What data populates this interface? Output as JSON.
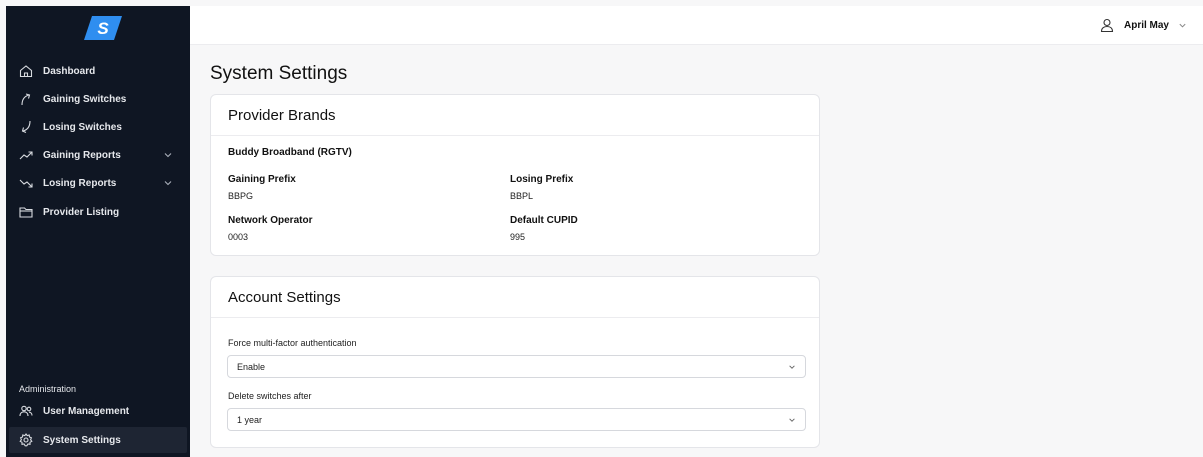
{
  "logo": {
    "letter": "S",
    "color": "#2f8ef0"
  },
  "sidebar": {
    "items": [
      {
        "label": "Dashboard",
        "icon": "home-icon"
      },
      {
        "label": "Gaining Switches",
        "icon": "arrow-up-icon"
      },
      {
        "label": "Losing Switches",
        "icon": "arrow-down-icon"
      },
      {
        "label": "Gaining Reports",
        "icon": "trending-up-icon",
        "expandable": true
      },
      {
        "label": "Losing Reports",
        "icon": "trending-down-icon",
        "expandable": true
      },
      {
        "label": "Provider Listing",
        "icon": "folder-icon"
      }
    ],
    "admin_heading": "Administration",
    "admin_items": [
      {
        "label": "User Management",
        "icon": "users-icon"
      },
      {
        "label": "System Settings",
        "icon": "gear-icon",
        "active": true
      }
    ]
  },
  "topbar": {
    "user_name": "April May",
    "user_icon": "user-icon"
  },
  "page": {
    "title": "System Settings"
  },
  "provider_brands": {
    "title": "Provider Brands",
    "brand_name": "Buddy Broadband (RGTV)",
    "fields": [
      {
        "label": "Gaining Prefix",
        "value": "BBPG"
      },
      {
        "label": "Losing Prefix",
        "value": "BBPL"
      },
      {
        "label": "Network Operator",
        "value": "0003"
      },
      {
        "label": "Default CUPID",
        "value": "995"
      }
    ]
  },
  "account_settings": {
    "title": "Account Settings",
    "mfa_label": "Force multi-factor authentication",
    "mfa_value": "Enable",
    "delete_label": "Delete switches after",
    "delete_value": "1 year"
  },
  "colors": {
    "sidebar_bg": "#0f1623",
    "active_item_bg": "#1e2533",
    "page_bg": "#f7f7f8",
    "accent": "#2f8ef0"
  }
}
